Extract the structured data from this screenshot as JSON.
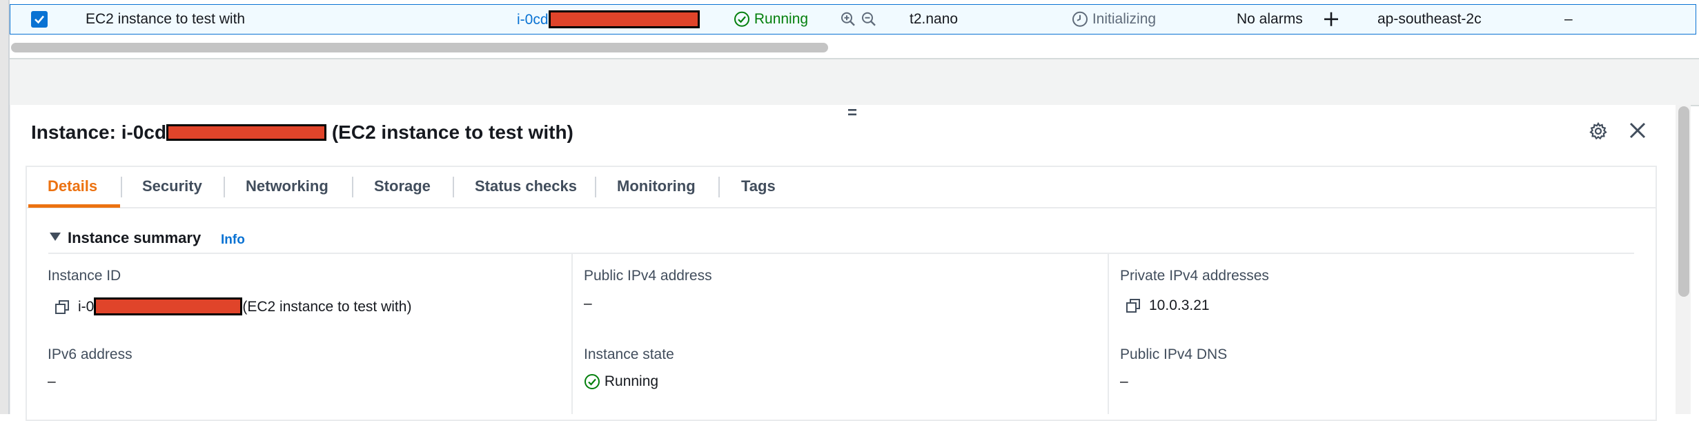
{
  "row": {
    "name": "EC2 instance to test with",
    "instance_id_prefix": "i-0cd",
    "state": "Running",
    "instance_type": "t2.nano",
    "status_check": "Initializing",
    "alarms": "No alarms",
    "add_alarm": "+",
    "availability_zone": "ap-southeast-2c",
    "public_dns": "–"
  },
  "panel": {
    "title_prefix": "Instance: i-0cd",
    "title_suffix": "(EC2 instance to test with)",
    "tabs": [
      "Details",
      "Security",
      "Networking",
      "Storage",
      "Status checks",
      "Monitoring",
      "Tags"
    ],
    "summary_title": "Instance summary",
    "info_link": "Info",
    "fields": {
      "instance_id": {
        "label": "Instance ID",
        "prefix": "i-0",
        "suffix": "(EC2 instance to test with)"
      },
      "public_ipv4": {
        "label": "Public IPv4 address",
        "value": "–"
      },
      "private_ipv4": {
        "label": "Private IPv4 addresses",
        "value": "10.0.3.21"
      },
      "ipv6": {
        "label": "IPv6 address",
        "value": "–"
      },
      "instance_state": {
        "label": "Instance state",
        "value": "Running"
      },
      "public_dns": {
        "label": "Public IPv4 DNS",
        "value": "–"
      }
    }
  },
  "colors": {
    "accent": "#ec7211",
    "link": "#0972d3",
    "success": "#037f0c",
    "redaction": "#e0442a"
  },
  "icons": [
    "checkbox-checked-icon",
    "status-running-icon",
    "zoom-in-icon",
    "zoom-out-icon",
    "clock-icon",
    "plus-icon",
    "drag-handle-icon",
    "gear-icon",
    "close-icon",
    "copy-icon",
    "caret-down-icon"
  ]
}
